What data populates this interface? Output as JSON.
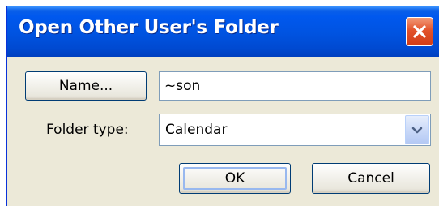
{
  "window": {
    "title": "Open Other User's Folder"
  },
  "form": {
    "name_button": "Name...",
    "name_value": "~son",
    "folder_type_label": "Folder type:",
    "folder_type_value": "Calendar"
  },
  "buttons": {
    "ok": "OK",
    "cancel": "Cancel"
  },
  "colors": {
    "titlebar": "#0058ee",
    "dialog_bg": "#ece9d8",
    "close_button": "#e2522a"
  },
  "icons": {
    "close": "close-icon",
    "dropdown": "chevron-down-icon"
  }
}
